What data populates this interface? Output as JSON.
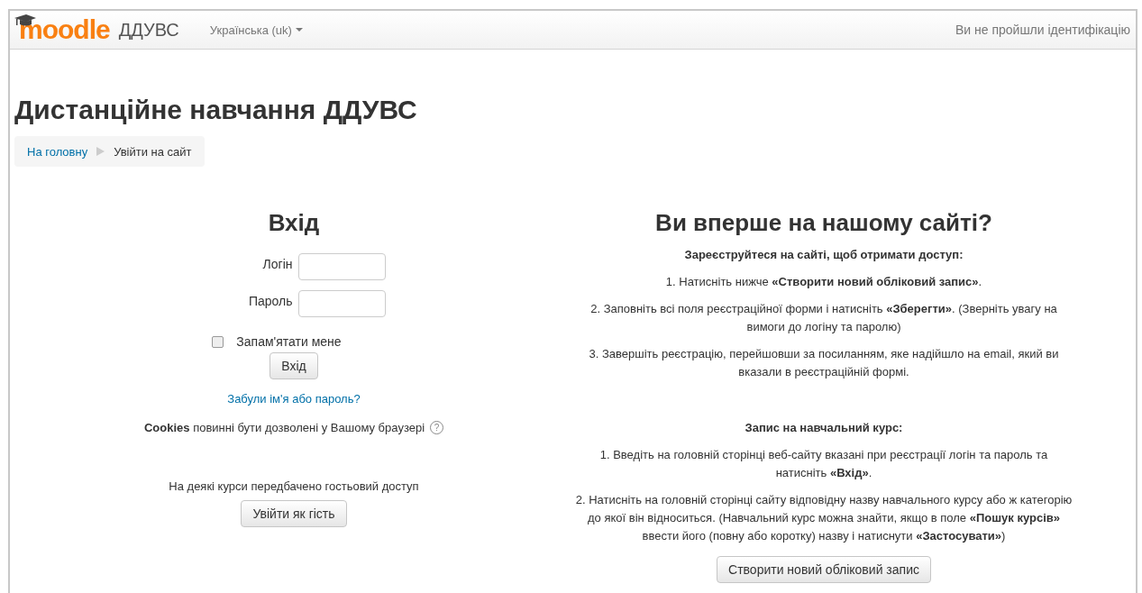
{
  "navbar": {
    "logo_text": "moodle",
    "site_name": "ДДУВС",
    "language": "Українська (uk)",
    "login_status": "Ви не пройшли ідентифікацію"
  },
  "page_title": "Дистанційне навчання ДДУВС",
  "breadcrumb": [
    {
      "label": "На головну",
      "kind": "link"
    },
    {
      "label": "Увійти на сайт",
      "kind": "current"
    }
  ],
  "login": {
    "heading": "Вхід",
    "fields": [
      {
        "label": "Логін"
      },
      {
        "label": "Пароль"
      }
    ],
    "remember": {
      "label": "Запам'ятати мене",
      "checked": false
    },
    "submit": "Вхід",
    "forgot_link": "Забули ім'я або пароль?",
    "cookies_note": "**Cookies** повинні бути дозволені у Вашому браузері",
    "help_icon": "?",
    "guest_note": "На деякі курси передбачено гостьовий доступ",
    "guest_button": "Увійти як гість"
  },
  "signup": {
    "heading": "Ви вперше на нашому сайті?",
    "sections": [
      {
        "title": "Зареєструйтеся на сайті, щоб отримати доступ:",
        "steps": [
          "1. Натисніть нижче **«Створити новий обліковий запис»**.",
          "2. Заповніть всі поля реєстраційної форми і натисніть **«Зберегти»**. (Зверніть увагу на вимоги до логіну та паролю)",
          "3. Завершіть реєстрацію, перейшовши за посиланням, яке надійшло на email, який ви вказали в реєстраційній формі."
        ]
      },
      {
        "title": "Запис на навчальний курс:",
        "steps": [
          "1. Введіть на головній сторінці веб-сайту вказані при реєстрації логін та пароль та натисніть **«Вхід»**.",
          "2. Натисніть на головній сторінці сайту відповідну назву навчального курсу або ж категорію до якої він відноситься. (Навчальний курс можна знайти, якщо в поле **«Пошук курсів»** ввести його (повну або коротку) назву і натиснути **«Застосувати»**)"
        ]
      }
    ],
    "button": "Створити новий обліковий запис"
  }
}
